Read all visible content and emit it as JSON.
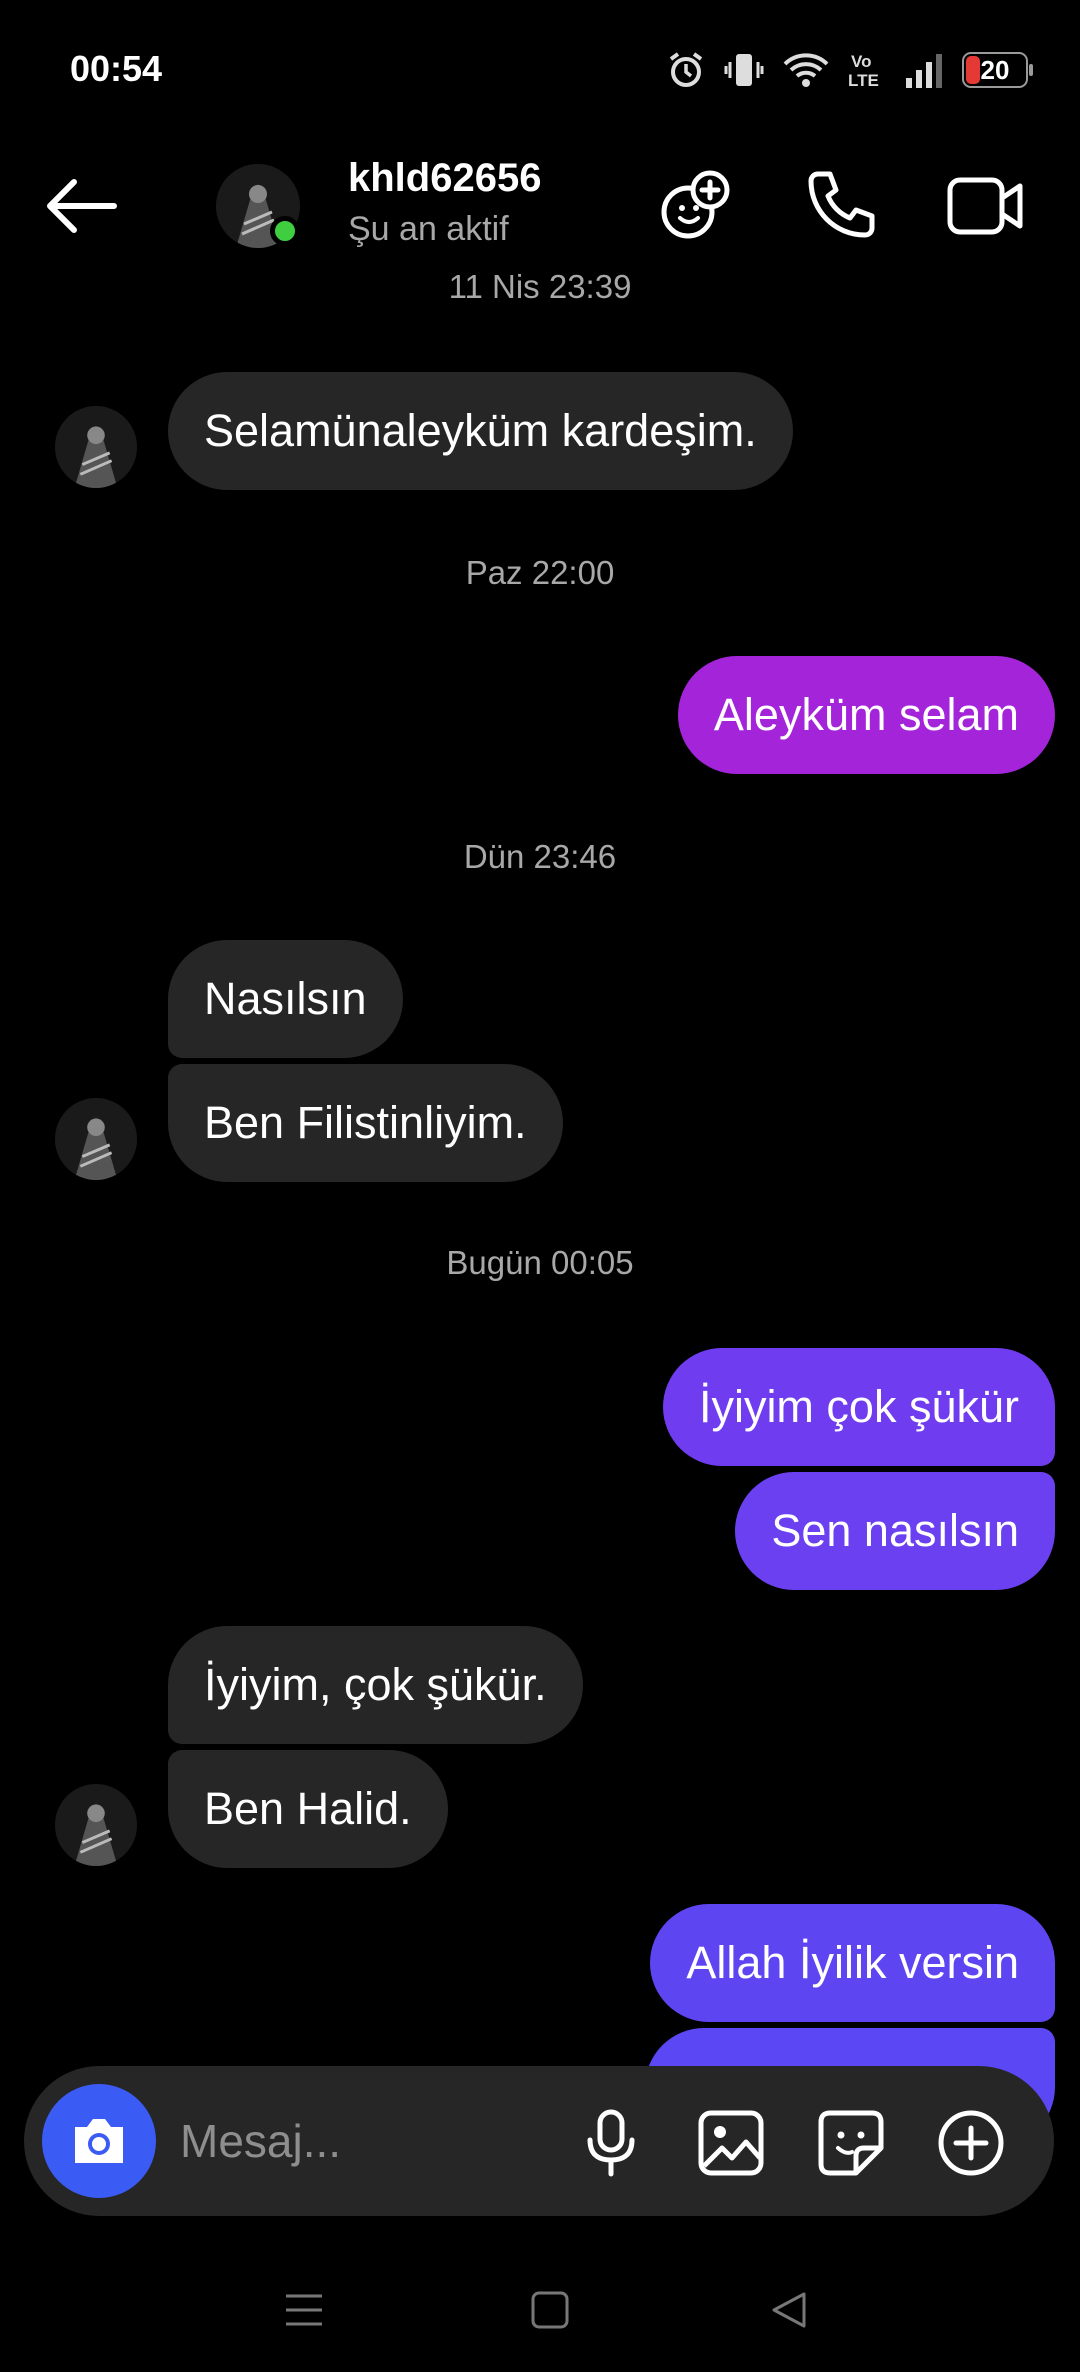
{
  "status_bar": {
    "time": "00:54",
    "battery": "20",
    "network": "Vo LTE"
  },
  "header": {
    "username": "khld62656",
    "status": "Şu an aktif"
  },
  "messages": [
    {
      "type": "timestamp",
      "text": "11 Nis 23:39"
    },
    {
      "type": "incoming",
      "text": "Selamünaleyküm kardeşim."
    },
    {
      "type": "timestamp",
      "text": "Paz 22:00"
    },
    {
      "type": "outgoing",
      "text": "Aleyküm selam",
      "color": "#a425d9"
    },
    {
      "type": "timestamp",
      "text": "Dün 23:46"
    },
    {
      "type": "incoming",
      "text": "Nasılsın"
    },
    {
      "type": "incoming",
      "text": "Ben Filistinliyim."
    },
    {
      "type": "timestamp",
      "text": "Bugün 00:05"
    },
    {
      "type": "outgoing",
      "text": "İyiyim çok şükür",
      "color": "#6f3cf0"
    },
    {
      "type": "outgoing",
      "text": "Sen nasılsın",
      "color": "#6a40f1"
    },
    {
      "type": "incoming",
      "text": "İyiyim, çok şükür."
    },
    {
      "type": "incoming",
      "text": "Ben Halid."
    },
    {
      "type": "outgoing",
      "text": "Allah İyilik versin",
      "color": "#5d46f2"
    },
    {
      "type": "outgoing",
      "text": "",
      "color": "#5b47f3"
    }
  ],
  "composer": {
    "placeholder": "Mesaj..."
  },
  "colors": {
    "accent_camera": "#3b5bf5",
    "online": "#3fce3f",
    "incoming_bubble": "#262626"
  },
  "icons": [
    "back-arrow-icon",
    "effects-icon",
    "phone-icon",
    "video-icon",
    "camera-icon",
    "microphone-icon",
    "gallery-icon",
    "sticker-icon",
    "plus-icon"
  ]
}
